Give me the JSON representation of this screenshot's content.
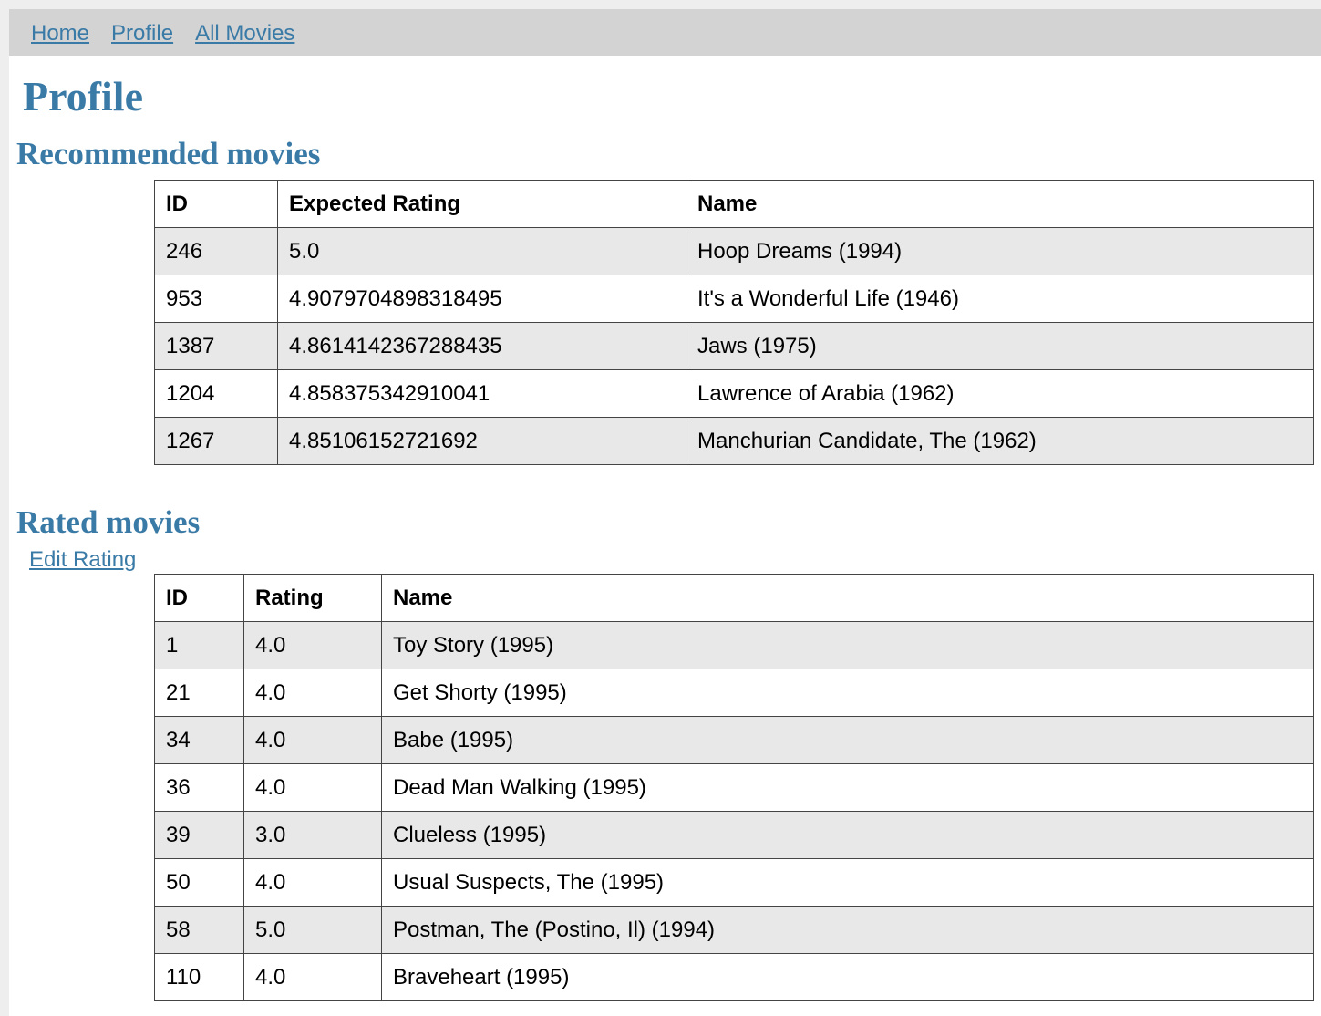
{
  "nav": {
    "home": "Home",
    "profile": "Profile",
    "all_movies": "All Movies"
  },
  "page_title": "Profile",
  "recommended": {
    "heading": "Recommended movies",
    "columns": [
      "ID",
      "Expected Rating",
      "Name"
    ],
    "rows": [
      [
        "246",
        "5.0",
        "Hoop Dreams (1994)"
      ],
      [
        "953",
        "4.9079704898318495",
        "It's a Wonderful Life (1946)"
      ],
      [
        "1387",
        "4.8614142367288435",
        "Jaws (1975)"
      ],
      [
        "1204",
        "4.858375342910041",
        "Lawrence of Arabia (1962)"
      ],
      [
        "1267",
        "4.85106152721692",
        "Manchurian Candidate, The (1962)"
      ]
    ]
  },
  "rated": {
    "heading": "Rated movies",
    "edit_link": "Edit Rating",
    "columns": [
      "ID",
      "Rating",
      "Name"
    ],
    "rows": [
      [
        "1",
        "4.0",
        "Toy Story (1995)"
      ],
      [
        "21",
        "4.0",
        "Get Shorty (1995)"
      ],
      [
        "34",
        "4.0",
        "Babe (1995)"
      ],
      [
        "36",
        "4.0",
        "Dead Man Walking (1995)"
      ],
      [
        "39",
        "3.0",
        "Clueless (1995)"
      ],
      [
        "50",
        "4.0",
        "Usual Suspects, The (1995)"
      ],
      [
        "58",
        "5.0",
        "Postman, The (Postino, Il) (1994)"
      ],
      [
        "110",
        "4.0",
        "Braveheart (1995)"
      ]
    ]
  },
  "colors": {
    "link": "#3a7aa6",
    "navbar_bg": "#d3d3d3",
    "row_stripe": "#e8e8e8"
  }
}
